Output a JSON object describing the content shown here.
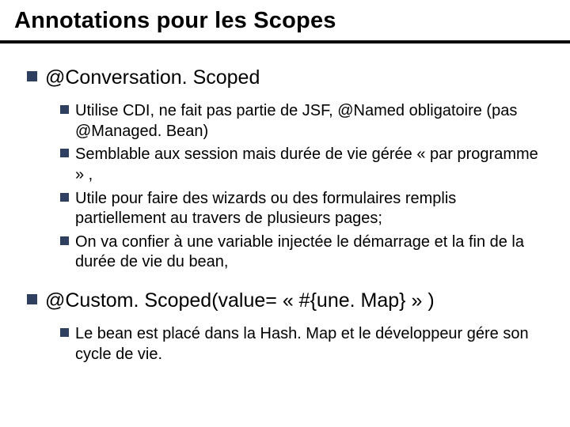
{
  "title": "Annotations pour les Scopes",
  "items": [
    {
      "label": "@Conversation. Scoped",
      "sub": [
        "Utilise CDI, ne fait pas partie de JSF, @Named obligatoire (pas @Managed. Bean)",
        "Semblable aux session mais durée de vie gérée « par programme » ,",
        "Utile pour faire des wizards ou des formulaires remplis partiellement au travers de plusieurs pages;",
        "On va confier à une variable injectée le démarrage et la fin de la durée de vie du bean,"
      ]
    },
    {
      "label": "@Custom. Scoped(value= « #{une. Map} » )",
      "sub": [
        "Le bean est placé dans la Hash. Map et le développeur gére son cycle de vie."
      ]
    }
  ]
}
